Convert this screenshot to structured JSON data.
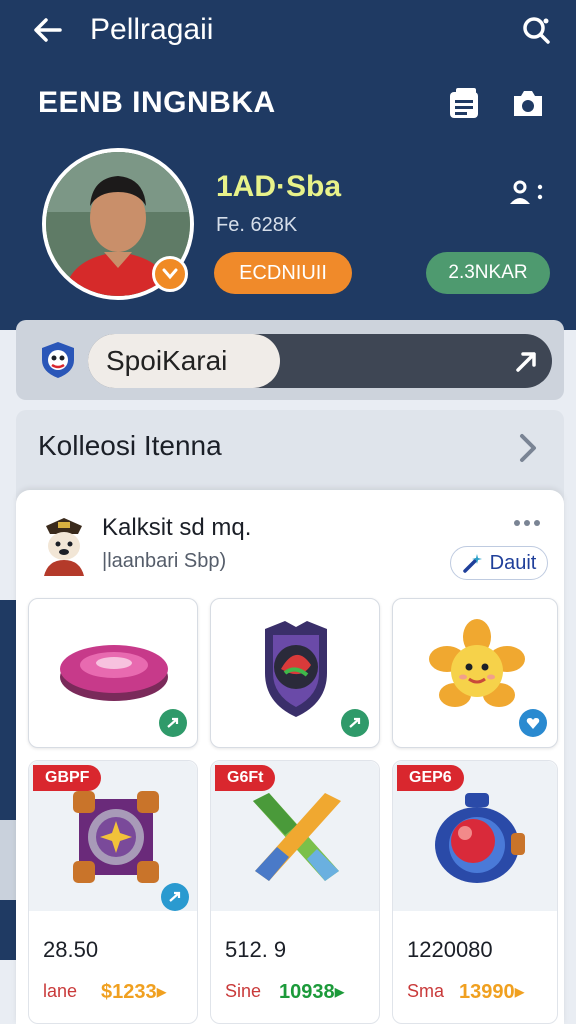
{
  "topbar": {
    "title": "Pellragaii"
  },
  "header": {
    "title": "EENB INGNBKA"
  },
  "profile": {
    "name": "1AD·Sba",
    "meta": "Fe. 628K",
    "primary_pill": "ECDNIUII",
    "secondary_pill": "2.3NKAR"
  },
  "spot": {
    "field_text": "SpoiKarai"
  },
  "collection": {
    "title": "Kolleosi Itenna"
  },
  "panel": {
    "title": "Kalksit sd mq.",
    "subtitle": "|laanbari Sbp)",
    "action_label": "Dauit"
  },
  "grid_items": [
    {
      "tag": "",
      "name": "disc-item"
    },
    {
      "tag": "",
      "name": "shield-item"
    },
    {
      "tag": "",
      "name": "flower-item"
    }
  ],
  "price_items": [
    {
      "tag": "GBPF",
      "value": "28.50",
      "label": "lane",
      "amount": "$1233▸",
      "amount_color": "#f0a020"
    },
    {
      "tag": "G6Ft",
      "value": "512. 9",
      "label": "Sine",
      "amount": "10938▸",
      "amount_color": "#1c9a3a"
    },
    {
      "tag": "GEP6",
      "value": "1220080",
      "label": "Sma",
      "amount": "13990▸",
      "amount_color": "#f0a020"
    }
  ],
  "colors": {
    "header_bg": "#1f3a63",
    "accent_orange": "#f08a2a",
    "accent_green": "#4e9a6f",
    "tag_red": "#d9272e"
  }
}
